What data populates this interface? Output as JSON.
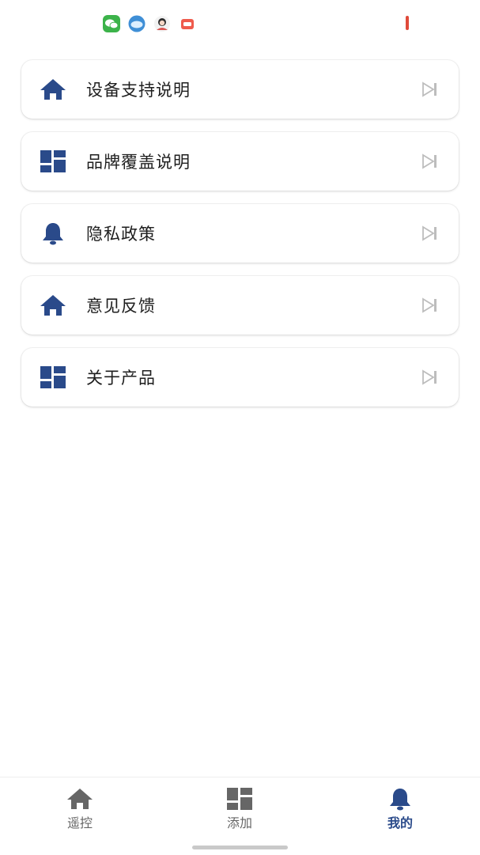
{
  "theme": {
    "accent": "#2a4a8a",
    "nav_inactive": "#666666",
    "arrow": "#bdbdbd"
  },
  "status_bar": {
    "notifications": [
      "wechat-icon",
      "cloud-icon",
      "avatar-icon",
      "shop-icon"
    ]
  },
  "menu": {
    "items": [
      {
        "label": "设备支持说明",
        "icon": "home-icon"
      },
      {
        "label": "品牌覆盖说明",
        "icon": "dashboard-icon"
      },
      {
        "label": "隐私政策",
        "icon": "bell-icon"
      },
      {
        "label": "意见反馈",
        "icon": "home-icon"
      },
      {
        "label": "关于产品",
        "icon": "dashboard-icon"
      }
    ]
  },
  "bottom_nav": {
    "items": [
      {
        "label": "遥控",
        "icon": "home-icon",
        "active": false
      },
      {
        "label": "添加",
        "icon": "dashboard-icon",
        "active": false
      },
      {
        "label": "我的",
        "icon": "bell-icon",
        "active": true
      }
    ]
  }
}
